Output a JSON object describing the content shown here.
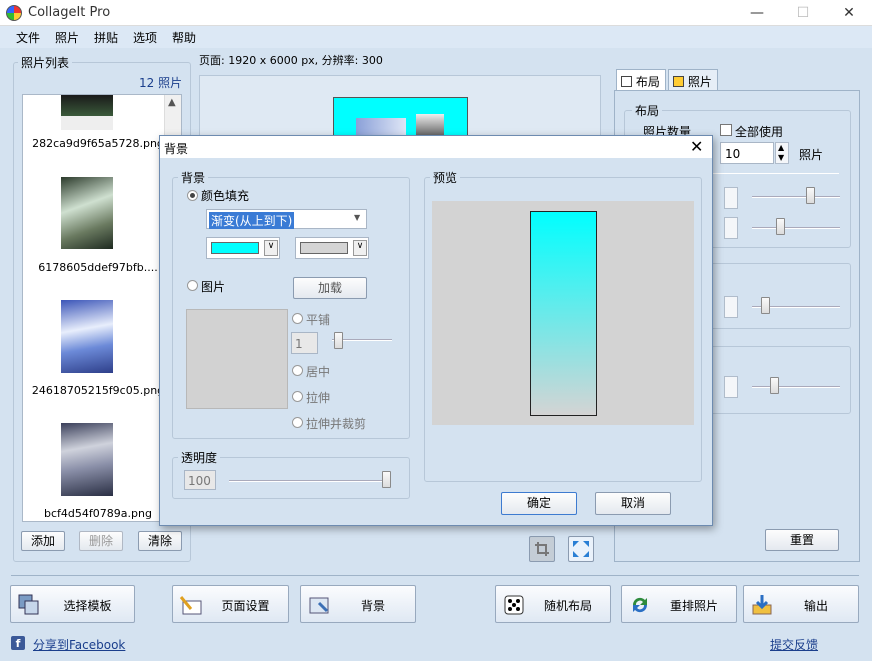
{
  "window": {
    "title": "CollageIt Pro"
  },
  "menu": [
    "文件",
    "照片",
    "拼贴",
    "选项",
    "帮助"
  ],
  "photo_list": {
    "title": "照片列表",
    "count": "12 照片",
    "items": [
      {
        "name": "282ca9d9f65a5728.png"
      },
      {
        "name": "6178605ddef97bfb...."
      },
      {
        "name": "24618705215f9c05.png"
      },
      {
        "name": "bcf4d54f0789a.png"
      }
    ],
    "buttons": {
      "add": "添加",
      "delete": "删除",
      "clear": "清除"
    }
  },
  "page_info": "页面: 1920 x 6000 px, 分辨率: 300",
  "right_panel": {
    "tabs": {
      "layout": "布局",
      "photo": "照片"
    },
    "layout_group": "布局",
    "photo_count_label": "照片数量",
    "use_all_label": "全部使用",
    "photo_count_value": "10",
    "photo_unit": "照片",
    "reset": "重置"
  },
  "dialog": {
    "title": "背景",
    "bg_group": "背景",
    "color_fill": "颜色填充",
    "gradient_value": "渐变(从上到下)",
    "color1": "#00ffff",
    "color2": "#d4d4d4",
    "image_option": "图片",
    "load": "加载",
    "tile": "平铺",
    "tile_value": "1",
    "center": "居中",
    "stretch": "拉伸",
    "stretch_crop": "拉伸并裁剪",
    "opacity_group": "透明度",
    "opacity_value": "100",
    "preview_group": "预览",
    "ok": "确定",
    "cancel": "取消"
  },
  "toolbar": {
    "select_template": "选择模板",
    "page_setup": "页面设置",
    "background": "背景",
    "random_layout": "随机布局",
    "shuffle_photos": "重排照片",
    "export": "输出"
  },
  "footer": {
    "share": "分享到Facebook",
    "feedback": "提交反馈"
  },
  "colors": {
    "accent": "#00ffff",
    "window_bg": "#d4e2f0"
  }
}
